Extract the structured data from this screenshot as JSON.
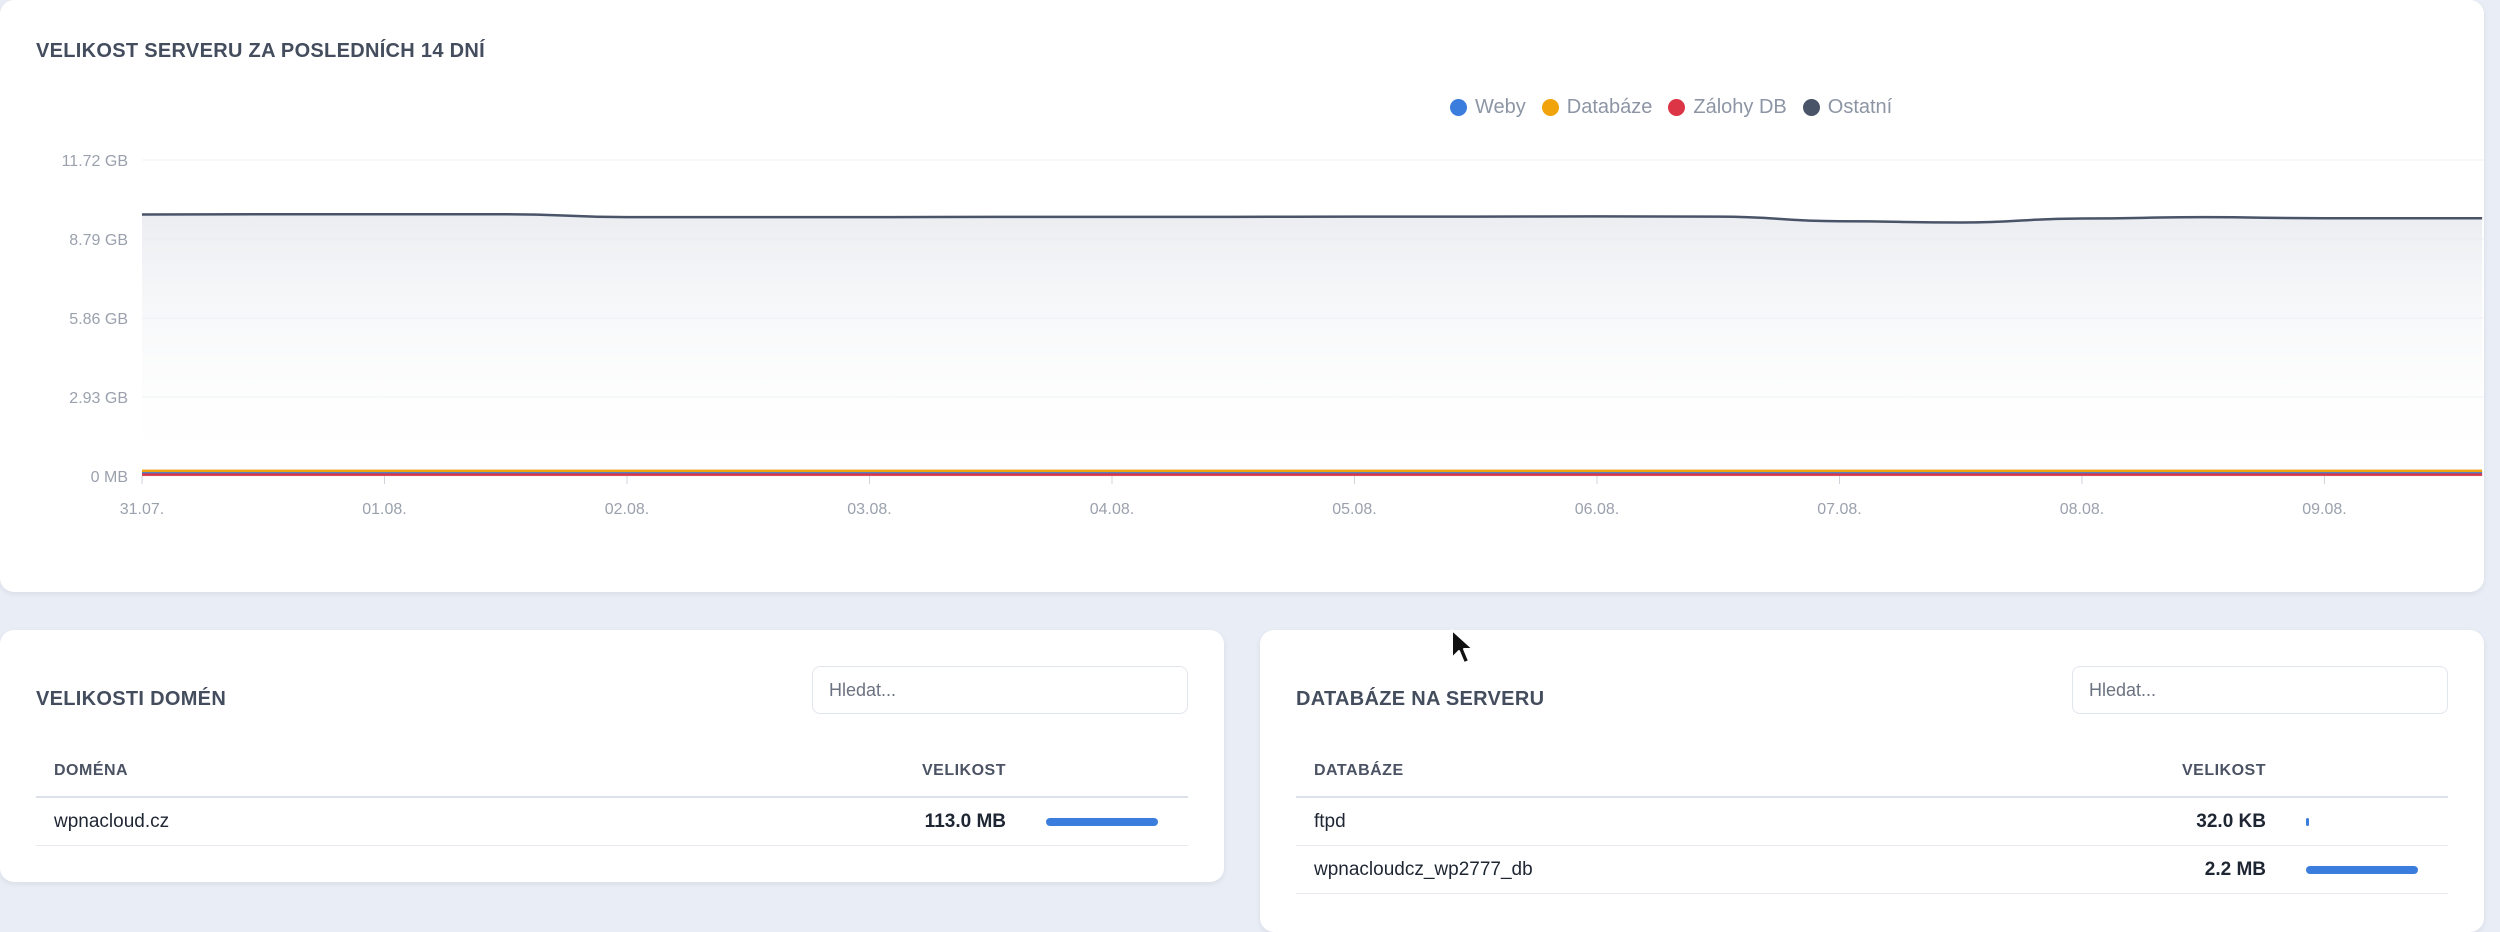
{
  "chart_card": {
    "title": "VELIKOST SERVERU ZA POSLEDNÍCH 14 DNÍ"
  },
  "chart_data": {
    "type": "line",
    "title": "VELIKOST SERVERU ZA POSLEDNÍCH 14 DNÍ",
    "x_ticks": [
      "31.07.",
      "01.08.",
      "02.08.",
      "03.08.",
      "04.08.",
      "05.08.",
      "06.08.",
      "07.08.",
      "08.08.",
      "09.08."
    ],
    "y_ticks": [
      "0 MB",
      "2.93 GB",
      "5.86 GB",
      "8.79 GB",
      "11.72 GB"
    ],
    "y_unit": "GB",
    "ylim": [
      0,
      11.72
    ],
    "x_days": [
      0,
      0.5,
      1,
      1.5,
      2,
      2.5,
      3,
      3.5,
      4,
      4.5,
      5,
      5.5,
      6,
      6.5,
      7,
      7.5,
      8,
      8.5,
      9,
      9.65
    ],
    "legend_position": "top-right",
    "grid": true,
    "series": [
      {
        "name": "Weby",
        "color": "#3b7ddd",
        "values": [
          0.11,
          0.11,
          0.11,
          0.11,
          0.11,
          0.11,
          0.11,
          0.11,
          0.11,
          0.11,
          0.11,
          0.11,
          0.11,
          0.11,
          0.11,
          0.11,
          0.11,
          0.11,
          0.11,
          0.11
        ]
      },
      {
        "name": "Databáze",
        "color": "#f0a30a",
        "values": [
          0.19,
          0.19,
          0.19,
          0.19,
          0.19,
          0.19,
          0.19,
          0.19,
          0.19,
          0.19,
          0.19,
          0.19,
          0.19,
          0.19,
          0.19,
          0.19,
          0.19,
          0.19,
          0.19,
          0.19
        ]
      },
      {
        "name": "Zálohy DB",
        "color": "#dc3545",
        "values": [
          0.05,
          0.05,
          0.05,
          0.05,
          0.05,
          0.05,
          0.05,
          0.05,
          0.05,
          0.05,
          0.05,
          0.05,
          0.05,
          0.05,
          0.05,
          0.05,
          0.05,
          0.05,
          0.05,
          0.05
        ]
      },
      {
        "name": "Ostatní",
        "color": "#4a5468",
        "values": [
          9.7,
          9.71,
          9.71,
          9.71,
          9.6,
          9.6,
          9.6,
          9.61,
          9.61,
          9.61,
          9.62,
          9.62,
          9.63,
          9.62,
          9.45,
          9.4,
          9.55,
          9.6,
          9.56,
          9.56
        ]
      }
    ]
  },
  "domains_card": {
    "title": "VELIKOSTI DOMÉN",
    "search_placeholder": "Hledat...",
    "columns": [
      "DOMÉNA",
      "VELIKOST"
    ],
    "rows": [
      {
        "name": "wpnacloud.cz",
        "size": "113.0 MB",
        "share": 1.0
      }
    ]
  },
  "db_card": {
    "title": "DATABÁZE NA SERVERU",
    "search_placeholder": "Hledat...",
    "columns": [
      "DATABÁZE",
      "VELIKOST"
    ],
    "rows": [
      {
        "name": "ftpd",
        "size": "32.0 KB",
        "share": 0.014
      },
      {
        "name": "wpnacloudcz_wp2777_db",
        "size": "2.2 MB",
        "share": 1.0
      }
    ]
  }
}
